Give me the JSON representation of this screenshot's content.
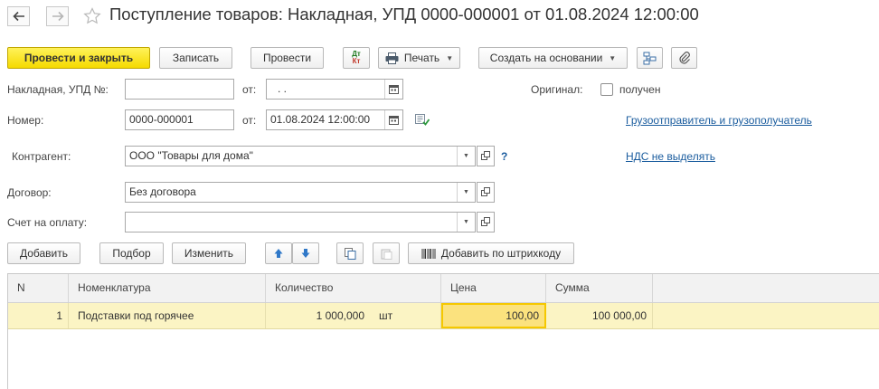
{
  "window": {
    "title": "Поступление товаров: Накладная, УПД 0000-000001 от 01.08.2024 12:00:00"
  },
  "toolbar": {
    "post_and_close": "Провести и закрыть",
    "save": "Записать",
    "post": "Провести",
    "dtkt_top": "Дт",
    "dtkt_bottom": "Кт",
    "print": "Печать",
    "create_based_on": "Создать на основании"
  },
  "form": {
    "invoice_label": "Накладная, УПД №:",
    "invoice_value": "",
    "invoice_date_label": "от:",
    "invoice_date_value": " .  .",
    "original_label": "Оригинал:",
    "original_checkbox_label": "получен",
    "number_label": "Номер:",
    "number_value": "0000-000001",
    "date_label": "от:",
    "date_value": "01.08.2024 12:00:00",
    "shipper_link": "Грузоотправитель и грузополучатель",
    "counterparty_label": "Контрагент:",
    "counterparty_value": "ООО \"Товары для дома\"",
    "help_mark": "?",
    "vat_link": "НДС не выделять",
    "contract_label": "Договор:",
    "contract_value": "Без договора",
    "payment_invoice_label": "Счет на оплату:",
    "payment_invoice_value": ""
  },
  "table_toolbar": {
    "add": "Добавить",
    "selection": "Подбор",
    "edit": "Изменить",
    "add_by_barcode": "Добавить по штрихкоду"
  },
  "table": {
    "columns": {
      "n": "N",
      "item": "Номенклатура",
      "qty": "Количество",
      "price": "Цена",
      "sum": "Сумма"
    },
    "rows": [
      {
        "n": "1",
        "item": "Подставки под горячее",
        "qty": "1 000,000",
        "unit": "шт",
        "price": "100,00",
        "sum": "100 000,00"
      }
    ]
  },
  "colors": {
    "primary_button": "#f5da00",
    "selected_row": "#fbf4c4",
    "current_cell": "#fbe27e",
    "link": "#1a5c9e"
  }
}
